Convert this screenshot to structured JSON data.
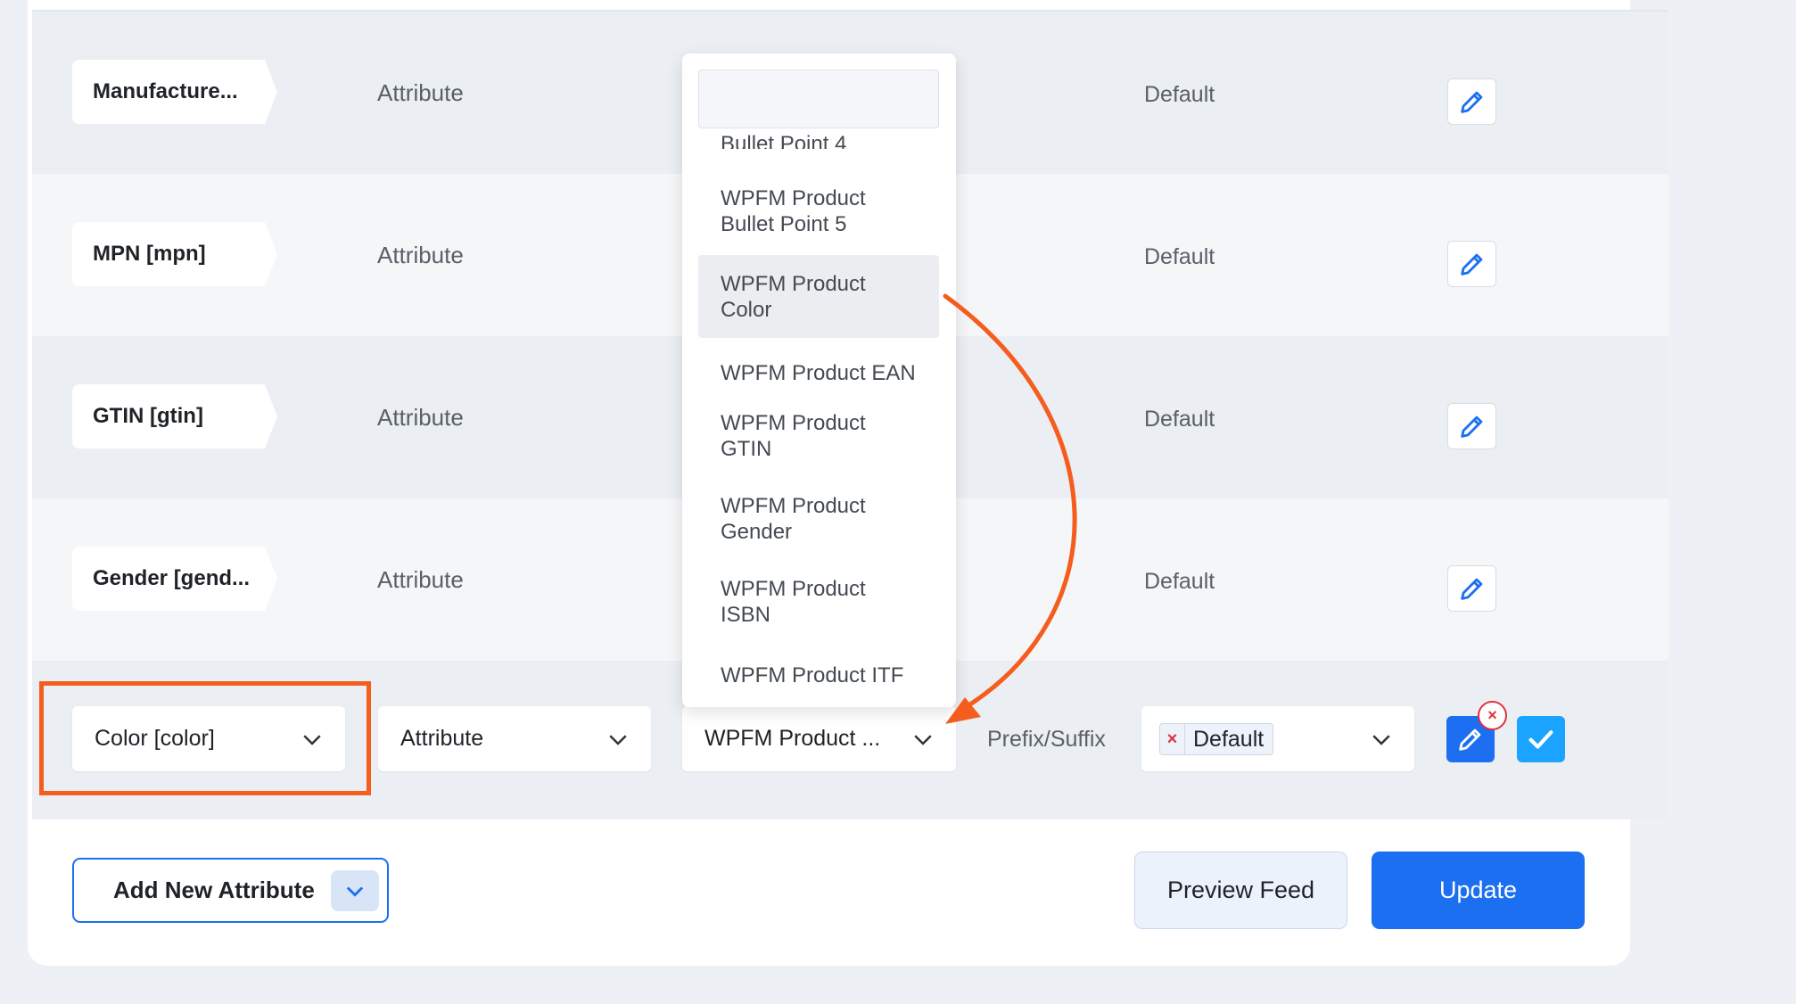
{
  "rows": [
    {
      "key": "Manufacture...",
      "type": "Attribute",
      "value": "Default"
    },
    {
      "key": "MPN [mpn]",
      "type": "Attribute",
      "value": "Default"
    },
    {
      "key": "GTIN [gtin]",
      "type": "Attribute",
      "value": "Default"
    },
    {
      "key": "Gender [gend...",
      "type": "Attribute",
      "value": "Default"
    }
  ],
  "edit_row": {
    "key_select": "Color [color]",
    "type_select": "Attribute",
    "value_select": "WPFM Product ...",
    "prefix_suffix": "Prefix/Suffix",
    "output_tag": "Default",
    "remove_symbol": "×"
  },
  "dropdown": {
    "search_value": "",
    "cut_item": "Bullet Point 4",
    "items": [
      {
        "line1": "WPFM Product",
        "line2": "Bullet Point 5"
      },
      {
        "line1": "WPFM Product",
        "line2": "Color"
      },
      {
        "line1": "WPFM Product EAN",
        "line2": ""
      },
      {
        "line1": "WPFM Product",
        "line2": "GTIN"
      },
      {
        "line1": "WPFM Product",
        "line2": "Gender"
      },
      {
        "line1": "WPFM Product",
        "line2": "ISBN"
      },
      {
        "line1": "WPFM Product ITF",
        "line2": ""
      }
    ],
    "active_index": 1
  },
  "footer": {
    "add_new_attribute": "Add New Attribute",
    "preview_feed": "Preview Feed",
    "update": "Update"
  },
  "colors": {
    "accent_blue": "#1b6ff0",
    "check_blue": "#1aa3ff",
    "annotation_orange": "#f45d1d",
    "remove_red": "#e0323c"
  },
  "icons": [
    "pencil-icon",
    "chevron-down-icon",
    "checkmark-icon",
    "close-icon",
    "annotation-arrow"
  ]
}
